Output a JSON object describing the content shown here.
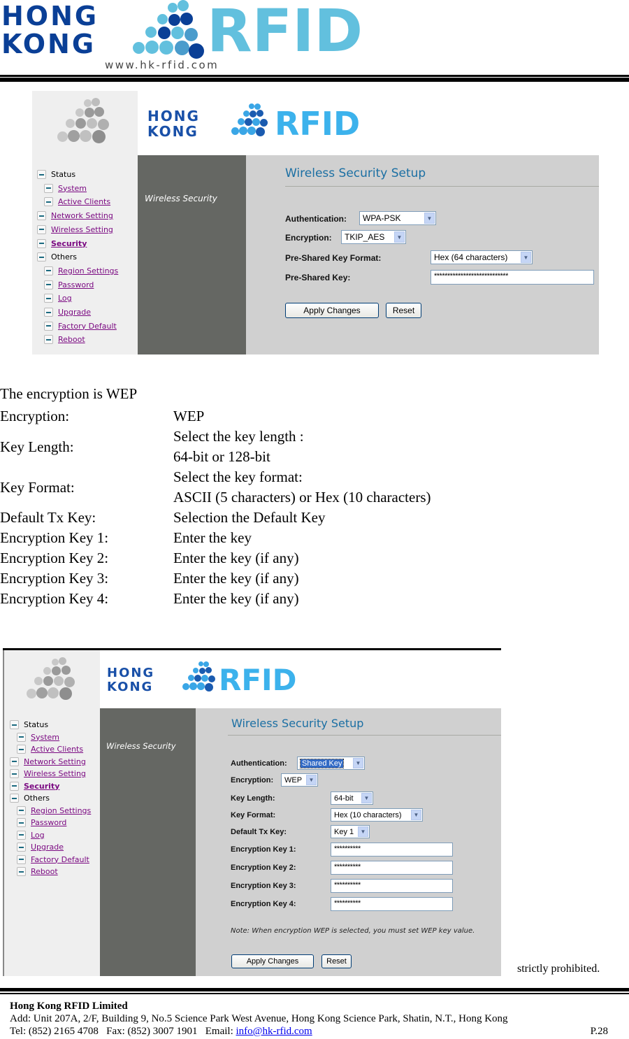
{
  "header": {
    "logo_line1": "HONG",
    "logo_line2": "KONG",
    "logo_brand": "RFID",
    "website": "www.hk-rfid.com"
  },
  "screenshot1": {
    "logo_line1": "HONG",
    "logo_line2": "KONG",
    "logo_brand": "RFID",
    "section_title": "Wireless Security",
    "page_title": "Wireless Security Setup",
    "nav": [
      {
        "label": "Status",
        "link": false,
        "level": 0
      },
      {
        "label": "System",
        "link": true,
        "level": 1
      },
      {
        "label": "Active Clients",
        "link": true,
        "level": 1
      },
      {
        "label": "Network Setting",
        "link": true,
        "level": 0
      },
      {
        "label": "Wireless Setting",
        "link": true,
        "level": 0
      },
      {
        "label": "Security",
        "link": true,
        "level": 0,
        "active": true
      },
      {
        "label": "Others",
        "link": false,
        "level": 0
      },
      {
        "label": "Region Settings",
        "link": true,
        "level": 1
      },
      {
        "label": "Password",
        "link": true,
        "level": 1
      },
      {
        "label": "Log",
        "link": true,
        "level": 1
      },
      {
        "label": "Upgrade",
        "link": true,
        "level": 1
      },
      {
        "label": "Factory Default",
        "link": true,
        "level": 1
      },
      {
        "label": "Reboot",
        "link": true,
        "level": 1
      }
    ],
    "form": {
      "authentication_label": "Authentication:",
      "authentication_value": "WPA-PSK",
      "encryption_label": "Encryption:",
      "encryption_value": "TKIP_AES",
      "psk_format_label": "Pre-Shared Key Format:",
      "psk_format_value": "Hex (64 characters)",
      "psk_label": "Pre-Shared Key:",
      "psk_value": "****************************",
      "apply_label": "Apply Changes",
      "reset_label": "Reset"
    }
  },
  "doc": {
    "heading": "The encryption is WEP",
    "rows": [
      {
        "label": "Encryption:",
        "desc": [
          "WEP"
        ]
      },
      {
        "label": "Key Length:",
        "desc": [
          "Select the key length :",
          "64-bit or  128-bit"
        ]
      },
      {
        "label": "Key Format:",
        "desc": [
          "Select the key format:",
          "ASCII (5 characters) or Hex (10 characters)"
        ]
      },
      {
        "label": "Default Tx Key:",
        "desc": [
          "Selection the Default Key"
        ]
      },
      {
        "label": "Encryption Key 1:",
        "desc": [
          "Enter the key"
        ]
      },
      {
        "label": "Encryption Key 2:",
        "desc": [
          "Enter the key (if any)"
        ]
      },
      {
        "label": "Encryption Key 3:",
        "desc": [
          "Enter the key (if any)"
        ]
      },
      {
        "label": "Encryption Key 4:",
        "desc": [
          "Enter the key (if any)"
        ]
      }
    ]
  },
  "screenshot2": {
    "logo_line1": "HONG",
    "logo_line2": "KONG",
    "logo_brand": "RFID",
    "section_title": "Wireless Security",
    "page_title": "Wireless Security Setup",
    "nav": [
      {
        "label": "Status",
        "link": false,
        "level": 0
      },
      {
        "label": "System",
        "link": true,
        "level": 1
      },
      {
        "label": "Active Clients",
        "link": true,
        "level": 1
      },
      {
        "label": "Network Setting",
        "link": true,
        "level": 0
      },
      {
        "label": "Wireless Setting",
        "link": true,
        "level": 0
      },
      {
        "label": "Security",
        "link": true,
        "level": 0,
        "active": true
      },
      {
        "label": "Others",
        "link": false,
        "level": 0
      },
      {
        "label": "Region Settings",
        "link": true,
        "level": 1
      },
      {
        "label": "Password",
        "link": true,
        "level": 1
      },
      {
        "label": "Log",
        "link": true,
        "level": 1
      },
      {
        "label": "Upgrade",
        "link": true,
        "level": 1
      },
      {
        "label": "Factory Default",
        "link": true,
        "level": 1
      },
      {
        "label": "Reboot",
        "link": true,
        "level": 1
      }
    ],
    "form": {
      "authentication_label": "Authentication:",
      "authentication_value": "Shared Key",
      "encryption_label": "Encryption:",
      "encryption_value": "WEP",
      "key_length_label": "Key Length:",
      "key_length_value": "64-bit",
      "key_format_label": "Key Format:",
      "key_format_value": "Hex (10 characters)",
      "default_tx_key_label": "Default Tx Key:",
      "default_tx_key_value": "Key 1",
      "key1_label": "Encryption Key 1:",
      "key1_value": "**********",
      "key2_label": "Encryption Key 2:",
      "key2_value": "**********",
      "key3_label": "Encryption Key 3:",
      "key3_value": "**********",
      "key4_label": "Encryption Key 4:",
      "key4_value": "**********",
      "note": "Note: When encryption WEP is selected, you must set WEP key value.",
      "apply_label": "Apply Changes",
      "reset_label": "Reset"
    }
  },
  "footer": {
    "partial_text": "strictly prohibited.",
    "company": "Hong Kong RFID Limited",
    "address": "Add: Unit 207A, 2/F, Building 9, No.5 Science Park West Avenue, Hong Kong Science Park, Shatin, N.T., Hong Kong",
    "contact_prefix": "Tel: (852) 2165 4708   Fax: (852) 3007 1901   Email: ",
    "email": "info@hk-rfid.com",
    "page": "P.28"
  }
}
